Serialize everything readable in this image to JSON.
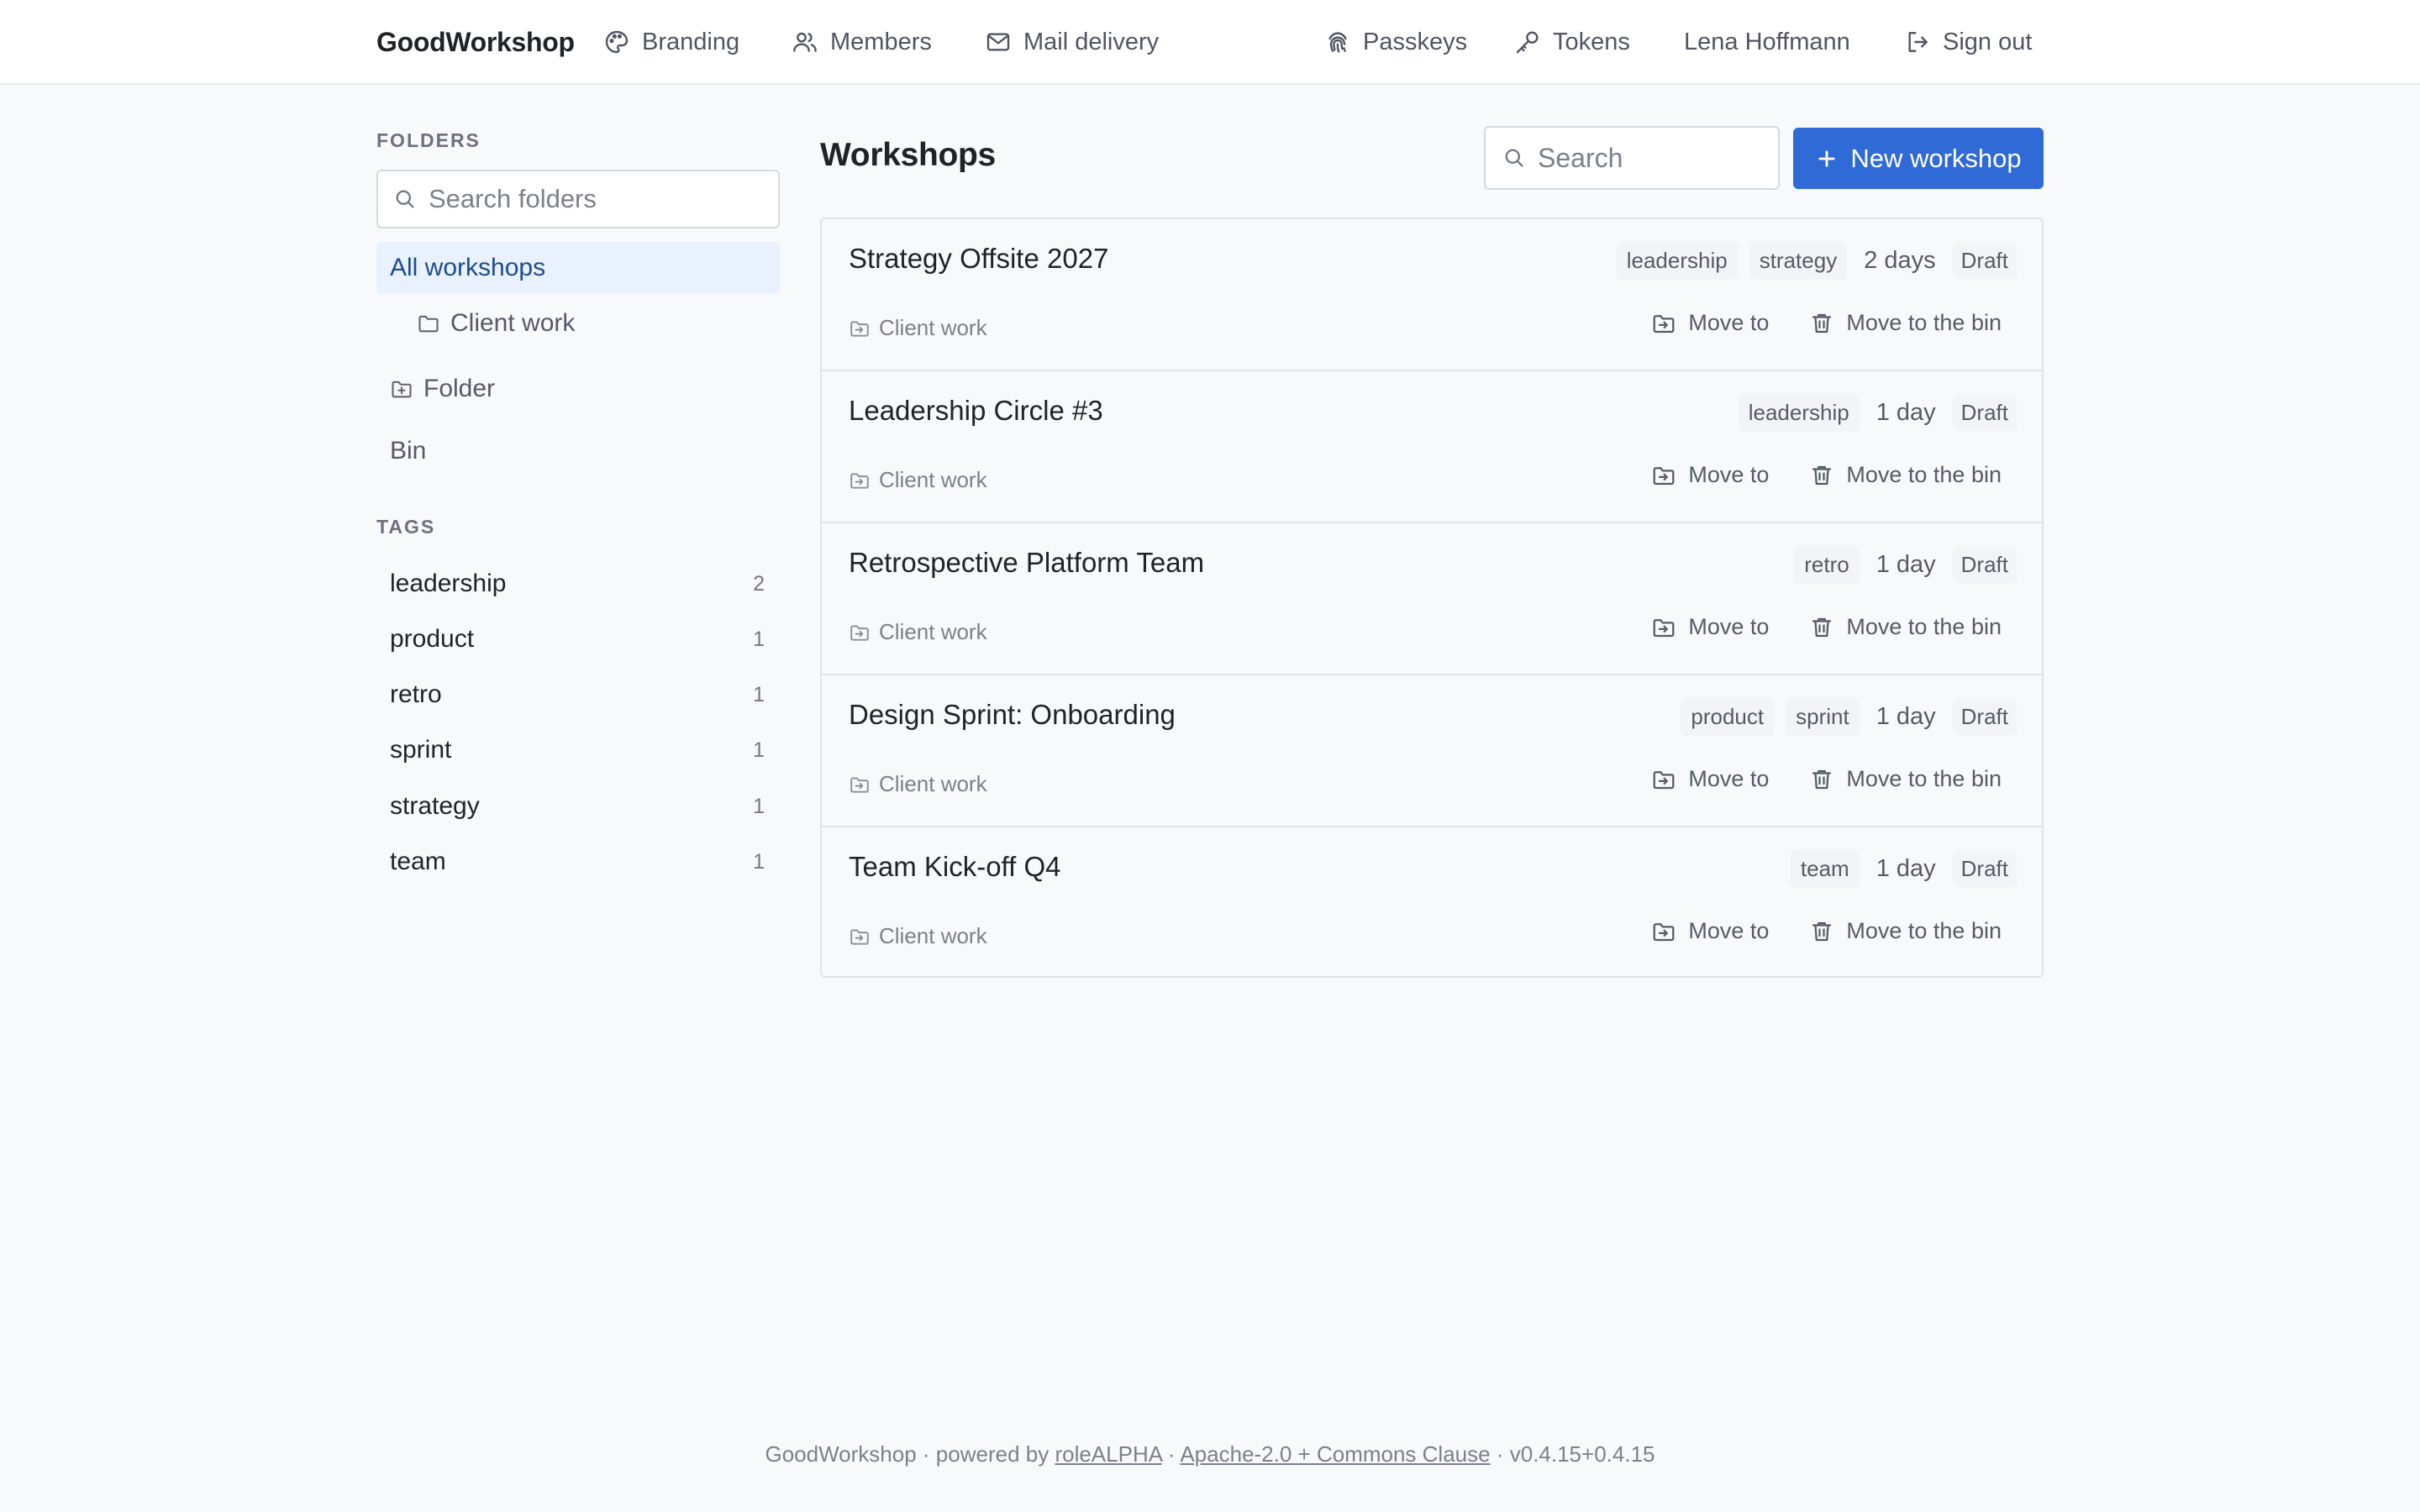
{
  "header": {
    "brand": "GoodWorkshop",
    "nav": {
      "branding": "Branding",
      "members": "Members",
      "mail_delivery": "Mail delivery",
      "passkeys": "Passkeys",
      "tokens": "Tokens",
      "user": "Lena Hoffmann",
      "sign_out": "Sign out"
    }
  },
  "sidebar": {
    "folders_heading": "FOLDERS",
    "search_placeholder": "Search folders",
    "all_workshops": "All workshops",
    "client_work": "Client work",
    "new_folder": "Folder",
    "bin": "Bin",
    "tags_heading": "TAGS",
    "tags": [
      {
        "name": "leadership",
        "count": "2"
      },
      {
        "name": "product",
        "count": "1"
      },
      {
        "name": "retro",
        "count": "1"
      },
      {
        "name": "sprint",
        "count": "1"
      },
      {
        "name": "strategy",
        "count": "1"
      },
      {
        "name": "team",
        "count": "1"
      }
    ]
  },
  "main": {
    "title": "Workshops",
    "search_placeholder": "Search",
    "new_button": "New workshop",
    "move_to_label": "Move to",
    "bin_label": "Move to the bin",
    "workshops": [
      {
        "title": "Strategy Offsite 2027",
        "tags": [
          "leadership",
          "strategy"
        ],
        "duration": "2 days",
        "status": "Draft",
        "folder": "Client work"
      },
      {
        "title": "Leadership Circle #3",
        "tags": [
          "leadership"
        ],
        "duration": "1 day",
        "status": "Draft",
        "folder": "Client work"
      },
      {
        "title": "Retrospective Platform Team",
        "tags": [
          "retro"
        ],
        "duration": "1 day",
        "status": "Draft",
        "folder": "Client work"
      },
      {
        "title": "Design Sprint: Onboarding",
        "tags": [
          "product",
          "sprint"
        ],
        "duration": "1 day",
        "status": "Draft",
        "folder": "Client work"
      },
      {
        "title": "Team Kick-off Q4",
        "tags": [
          "team"
        ],
        "duration": "1 day",
        "status": "Draft",
        "folder": "Client work"
      }
    ]
  },
  "footer": {
    "brand": "GoodWorkshop",
    "powered_by": "powered by",
    "role_link": "roleALPHA",
    "license_link": "Apache-2.0 + Commons Clause",
    "version": "v0.4.15+0.4.15",
    "sep": "·"
  },
  "colors": {
    "accent": "#2f6ad6",
    "active_bg": "#e8f1fd",
    "page_bg": "#f8f9fb"
  }
}
